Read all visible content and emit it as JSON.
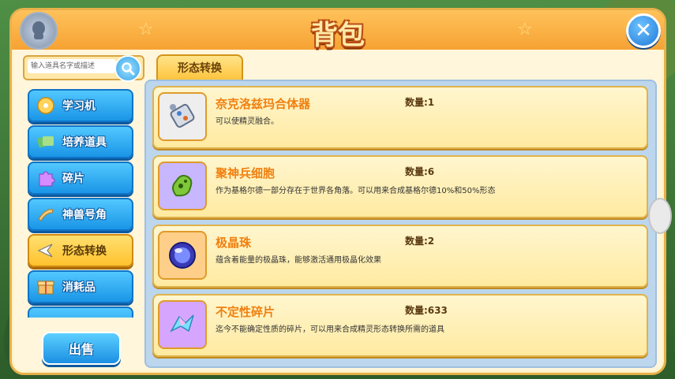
{
  "window": {
    "title": "背包"
  },
  "search": {
    "placeholder": "输入道具名字或描述"
  },
  "sidebar": {
    "items": [
      {
        "label": "学习机",
        "icon": "disc-icon",
        "active": false
      },
      {
        "label": "培养道具",
        "icon": "cards-icon",
        "active": false
      },
      {
        "label": "碎片",
        "icon": "puzzle-icon",
        "active": false
      },
      {
        "label": "神兽号角",
        "icon": "horn-icon",
        "active": false
      },
      {
        "label": "形态转换",
        "icon": "arrow-icon",
        "active": true
      },
      {
        "label": "消耗品",
        "icon": "box-icon",
        "active": false
      }
    ],
    "sell_label": "出售"
  },
  "tab": {
    "label": "形态转换"
  },
  "items": [
    {
      "name": "奈克洛兹玛合体器",
      "count": "数量:1",
      "desc": "可以使精灵融合。",
      "icon": "device-icon"
    },
    {
      "name": "聚神兵细胞",
      "count": "数量:6",
      "desc": "作为基格尔德一部分存在于世界各角落。可以用来合成基格尔德10%和50%形态",
      "icon": "cell-icon"
    },
    {
      "name": "极晶珠",
      "count": "数量:2",
      "desc": "蕴含着能量的极晶珠，能够激活通用极晶化效果",
      "icon": "orb-icon"
    },
    {
      "name": "不定性碎片",
      "count": "数量:633",
      "desc": "迄今不能确定性质的碎片，可以用来合成精灵形态转换所需的道具",
      "icon": "shard-icon"
    }
  ],
  "colors": {
    "accent": "#f6a233",
    "button_blue": "#1a95e6",
    "active_yellow": "#ffc22e"
  }
}
